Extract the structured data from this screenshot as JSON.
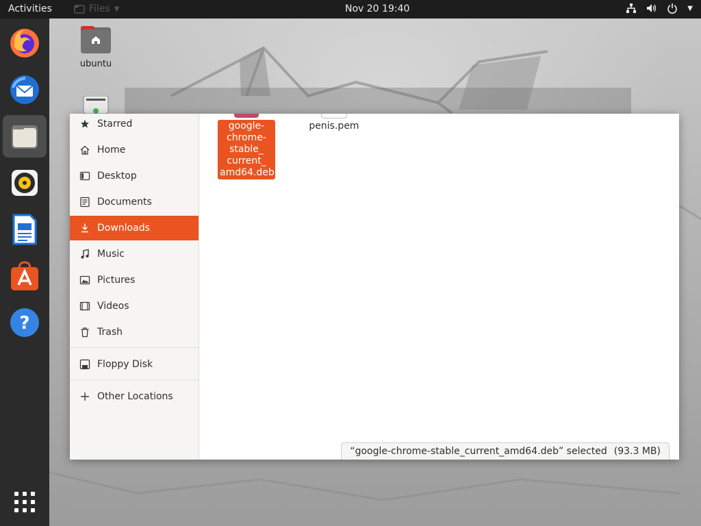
{
  "topbar": {
    "activities": "Activities",
    "app_name": "Files",
    "clock": "Nov 20  19:40"
  },
  "dock": {
    "items": [
      "firefox-icon",
      "thunderbird-icon",
      "files-icon",
      "rhythmbox-icon",
      "libreoffice-writer-icon",
      "software-center-icon",
      "help-icon"
    ],
    "active": "files-icon"
  },
  "desktop": {
    "home_label": "ubuntu"
  },
  "files": {
    "sidebar": {
      "items": [
        {
          "label": "Starred"
        },
        {
          "label": "Home"
        },
        {
          "label": "Desktop"
        },
        {
          "label": "Documents"
        },
        {
          "label": "Downloads"
        },
        {
          "label": "Music"
        },
        {
          "label": "Pictures"
        },
        {
          "label": "Videos"
        },
        {
          "label": "Trash"
        },
        {
          "label": "Floppy Disk"
        },
        {
          "label": "Other Locations"
        }
      ],
      "active": "Downloads"
    },
    "items": [
      {
        "name_lines": [
          "google-",
          "chrome-",
          "stable_",
          "current_",
          "amd64.deb"
        ],
        "selected": true
      },
      {
        "name": "penis.pem",
        "selected": false
      }
    ],
    "status": {
      "selection": "“google-chrome-stable_current_amd64.deb” selected",
      "size": "(93.3 MB)"
    }
  },
  "colors": {
    "accent": "#e95420",
    "topbar": "#1d1d1d",
    "dock": "#2b2b2b"
  }
}
